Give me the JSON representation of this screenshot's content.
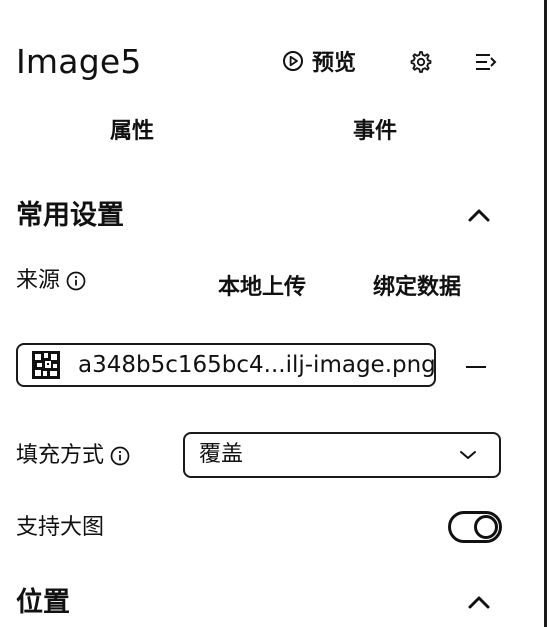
{
  "header": {
    "title": "Image5",
    "preview_label": "预览",
    "icons": [
      "play-circle-icon",
      "gear-icon",
      "collapse-menu-icon"
    ]
  },
  "tabs": [
    {
      "label": "属性"
    },
    {
      "label": "事件"
    }
  ],
  "sections": {
    "common": {
      "title": "常用设置"
    },
    "position": {
      "title": "位置"
    }
  },
  "source": {
    "label": "来源",
    "local_upload": "本地上传",
    "bind_data": "绑定数据",
    "file_name": "a348b5c165bc4...ilj-image.png"
  },
  "fill": {
    "label": "填充方式",
    "value": "覆盖"
  },
  "large_image": {
    "label": "支持大图",
    "enabled": true
  },
  "colors": {
    "text": "#111111",
    "border": "#1a1a1a",
    "background": "#ffffff"
  }
}
